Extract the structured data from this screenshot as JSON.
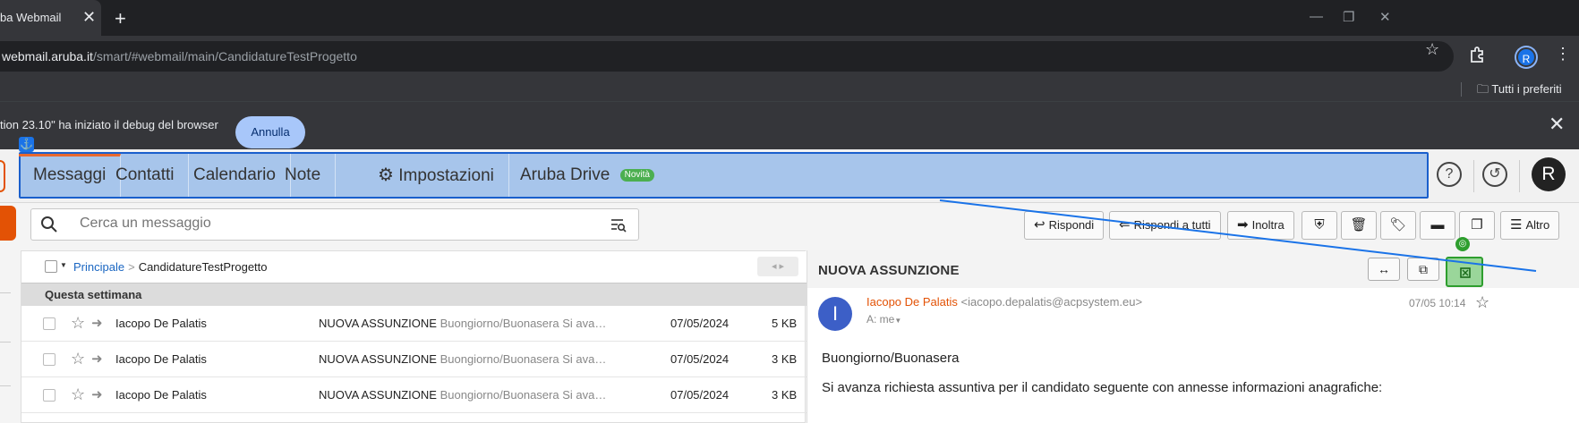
{
  "browser": {
    "tab_title": "ba Webmail",
    "tab_close": "✕",
    "new_tab": "+",
    "url_host": "webmail.aruba.it",
    "url_path": "/smart/#webmail/main/CandidatureTestProgetto",
    "profile_initial": "R",
    "bookmarks_folder": "Tutti i preferiti"
  },
  "infobar": {
    "message": "tion 23.10\" ha iniziato il debug del browser",
    "cancel_label": "Annulla",
    "close": "✕"
  },
  "nav": {
    "items": [
      {
        "label": "Messaggi"
      },
      {
        "label": "Contatti"
      },
      {
        "label": "Calendario"
      },
      {
        "label": "Note"
      },
      {
        "label": "Impostazioni"
      },
      {
        "label": "Aruba Drive",
        "badge": "Novità"
      }
    ],
    "avatar": "R",
    "help": "?"
  },
  "search": {
    "placeholder": "Cerca un messaggio"
  },
  "toolbar": {
    "reply": "Rispondi",
    "reply_all": "Rispondi a tutti",
    "forward": "Inoltra",
    "more": "Altro"
  },
  "list": {
    "breadcrumb_root": "Principale",
    "breadcrumb_sep": ">",
    "breadcrumb_folder": "CandidatureTestProgetto",
    "group": "Questa settimana",
    "rows": [
      {
        "sender": "Iacopo De Palatis",
        "subject": "NUOVA ASSUNZIONE",
        "preview": "Buongiorno/Buonasera Si ava…",
        "date": "07/05/2024",
        "size": "5 KB"
      },
      {
        "sender": "Iacopo De Palatis",
        "subject": "NUOVA ASSUNZIONE",
        "preview": "Buongiorno/Buonasera Si ava…",
        "date": "07/05/2024",
        "size": "3 KB"
      },
      {
        "sender": "Iacopo De Palatis",
        "subject": "NUOVA ASSUNZIONE",
        "preview": "Buongiorno/Buonasera Si ava…",
        "date": "07/05/2024",
        "size": "3 KB"
      }
    ]
  },
  "reading": {
    "title": "NUOVA ASSUNZIONE",
    "avatar": "I",
    "sender_name": "Iacopo De Palatis",
    "sender_email": "<iacopo.depalatis@acpsystem.eu>",
    "to": "A: me",
    "date": "07/05 10:14",
    "body_line1": "Buongiorno/Buonasera",
    "body_line2": "Si avanza richiesta assuntiva per il candidato seguente con annesse informazioni anagrafiche:"
  },
  "colors": {
    "brand": "#e35205",
    "link": "#1a66c2",
    "highlight": "#8eb6e8",
    "green_overlay": "#2e9e2e"
  }
}
